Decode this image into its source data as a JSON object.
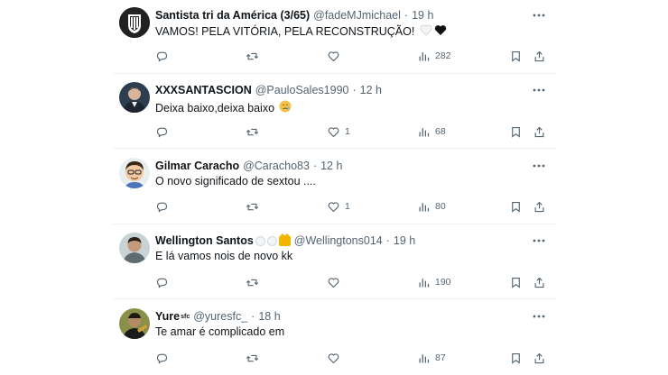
{
  "colors": {
    "text": "#0f1419",
    "muted": "#536471",
    "divider": "#eff3f4"
  },
  "tweets": [
    {
      "name": "Santista tri da América (3/65)",
      "handle": "@fadeMJmichael",
      "dot": "·",
      "time": "19 h",
      "text": "VAMOS! PELA VITÓRIA, PELA RECONSTRUÇÃO!",
      "like_count": "",
      "views": "282",
      "avatar_icon": "santos-crest-avatar"
    },
    {
      "name": "XXXSANTASCION",
      "handle": "@PauloSales1990",
      "dot": "·",
      "time": "12 h",
      "text": "Deixa baixo,deixa baixo",
      "like_count": "1",
      "views": "68",
      "avatar_icon": "user-photo-avatar"
    },
    {
      "name": "Gilmar Caracho",
      "handle": "@Caracho83",
      "dot": "·",
      "time": "12 h",
      "text": "O novo significado de sextou ....",
      "like_count": "1",
      "views": "80",
      "avatar_icon": "cartoon-avatar"
    },
    {
      "name": "Wellington Santos",
      "handle": "@Wellingtons014",
      "dot": "·",
      "time": "19 h",
      "text": "E lá vamos nois de novo kk",
      "like_count": "",
      "views": "190",
      "avatar_icon": "user-photo-avatar"
    },
    {
      "name": "Yure",
      "name_sup": "sfc",
      "handle": "@yuresfc_",
      "dot": "·",
      "time": "18 h",
      "text": "Te amar é complicado em",
      "like_count": "",
      "views": "87",
      "avatar_icon": "user-photo-avatar"
    }
  ]
}
